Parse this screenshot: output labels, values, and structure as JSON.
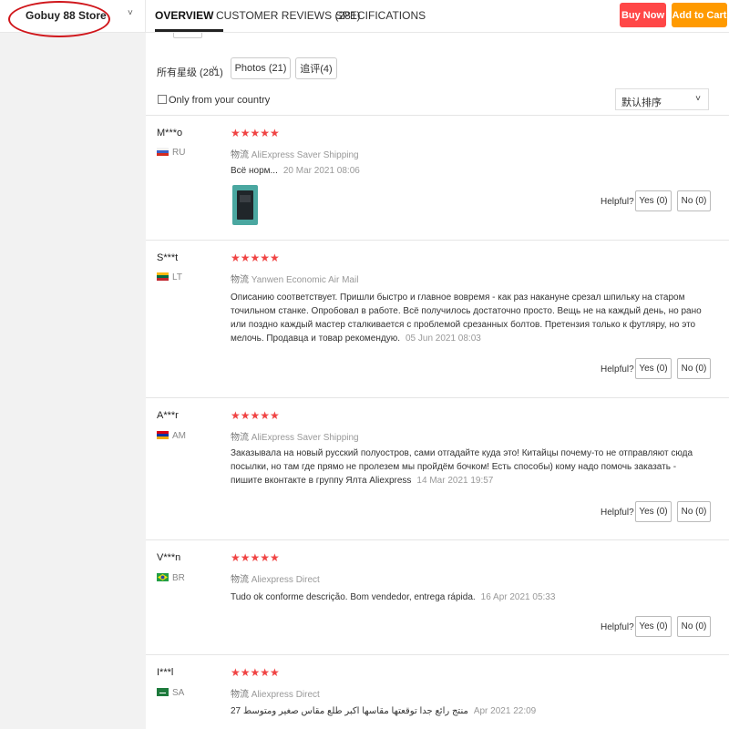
{
  "store": {
    "name": "Gobuy 88 Store",
    "chevron": "˅"
  },
  "tabs": [
    {
      "label": "OVERVIEW"
    },
    {
      "label": "CUSTOMER REVIEWS (281)"
    },
    {
      "label": "SPECIFICATIONS"
    }
  ],
  "actions": {
    "buy_now": "Buy Now",
    "add_to_cart": "Add to Cart"
  },
  "filters": {
    "rating_filter": "所有星级 (281)",
    "photos": "Photos (21)",
    "additional": "追评(4)",
    "only_country": "Only from your country",
    "sort": "默认排序"
  },
  "reviews": [
    {
      "name": "M***o",
      "country": "RU",
      "stars": "★★★★★",
      "ship_key": "物流",
      "shipping": "AliExpress Saver Shipping",
      "lines": [
        "Всё норм..."
      ],
      "date": "20 Mar 2021 08:06",
      "helpful": "Helpful?",
      "yes": "Yes (0)",
      "no": "No (0)"
    },
    {
      "name": "S***t",
      "country": "LT",
      "stars": "★★★★★",
      "ship_key": "物流",
      "shipping": "Yanwen Economic Air Mail",
      "lines": [
        "Описанию соответствует. Пришли быстро и главное вовремя - как раз накануне срезал шпильку на старом",
        "точильном станке. Опробовал в работе. Всё получилось достаточно просто. Вещь не на каждый день, но рано",
        "или поздно каждый мастер сталкивается с проблемой срезанных болтов. Претензия только к футляру, но это",
        "мелочь. Продавца и товар рекомендую."
      ],
      "date": "05 Jun 2021 08:03",
      "helpful": "Helpful?",
      "yes": "Yes (0)",
      "no": "No (0)"
    },
    {
      "name": "A***r",
      "country": "AM",
      "stars": "★★★★★",
      "ship_key": "物流",
      "shipping": "AliExpress Saver Shipping",
      "lines": [
        "Заказывала на новый русский полуостров, сами отгадайте куда это! Китайцы почему-то не отправляют сюда",
        "посылки, но там где прямо не пролезем мы пройдём бочком! Есть способы) кому надо помочь заказать -",
        "пишите вконтакте в группу Ялта Aliexpress"
      ],
      "date": "14 Mar 2021 19:57",
      "helpful": "Helpful?",
      "yes": "Yes (0)",
      "no": "No (0)"
    },
    {
      "name": "V***n",
      "country": "BR",
      "stars": "★★★★★",
      "ship_key": "物流",
      "shipping": "Aliexpress Direct",
      "lines": [
        "Tudo ok conforme descrição. Bom vendedor, entrega rápida."
      ],
      "date": "16 Apr 2021 05:33",
      "helpful": "Helpful?",
      "yes": "Yes (0)",
      "no": "No (0)"
    },
    {
      "name": "I***l",
      "country": "SA",
      "stars": "★★★★★",
      "ship_key": "物流",
      "shipping": "Aliexpress Direct",
      "lines": [
        "منتج رائع جدا توقعتها مقاسها اكبر طلع مقاس صغير ومتوسط 27"
      ],
      "date": "Apr 2021 22:09"
    }
  ]
}
